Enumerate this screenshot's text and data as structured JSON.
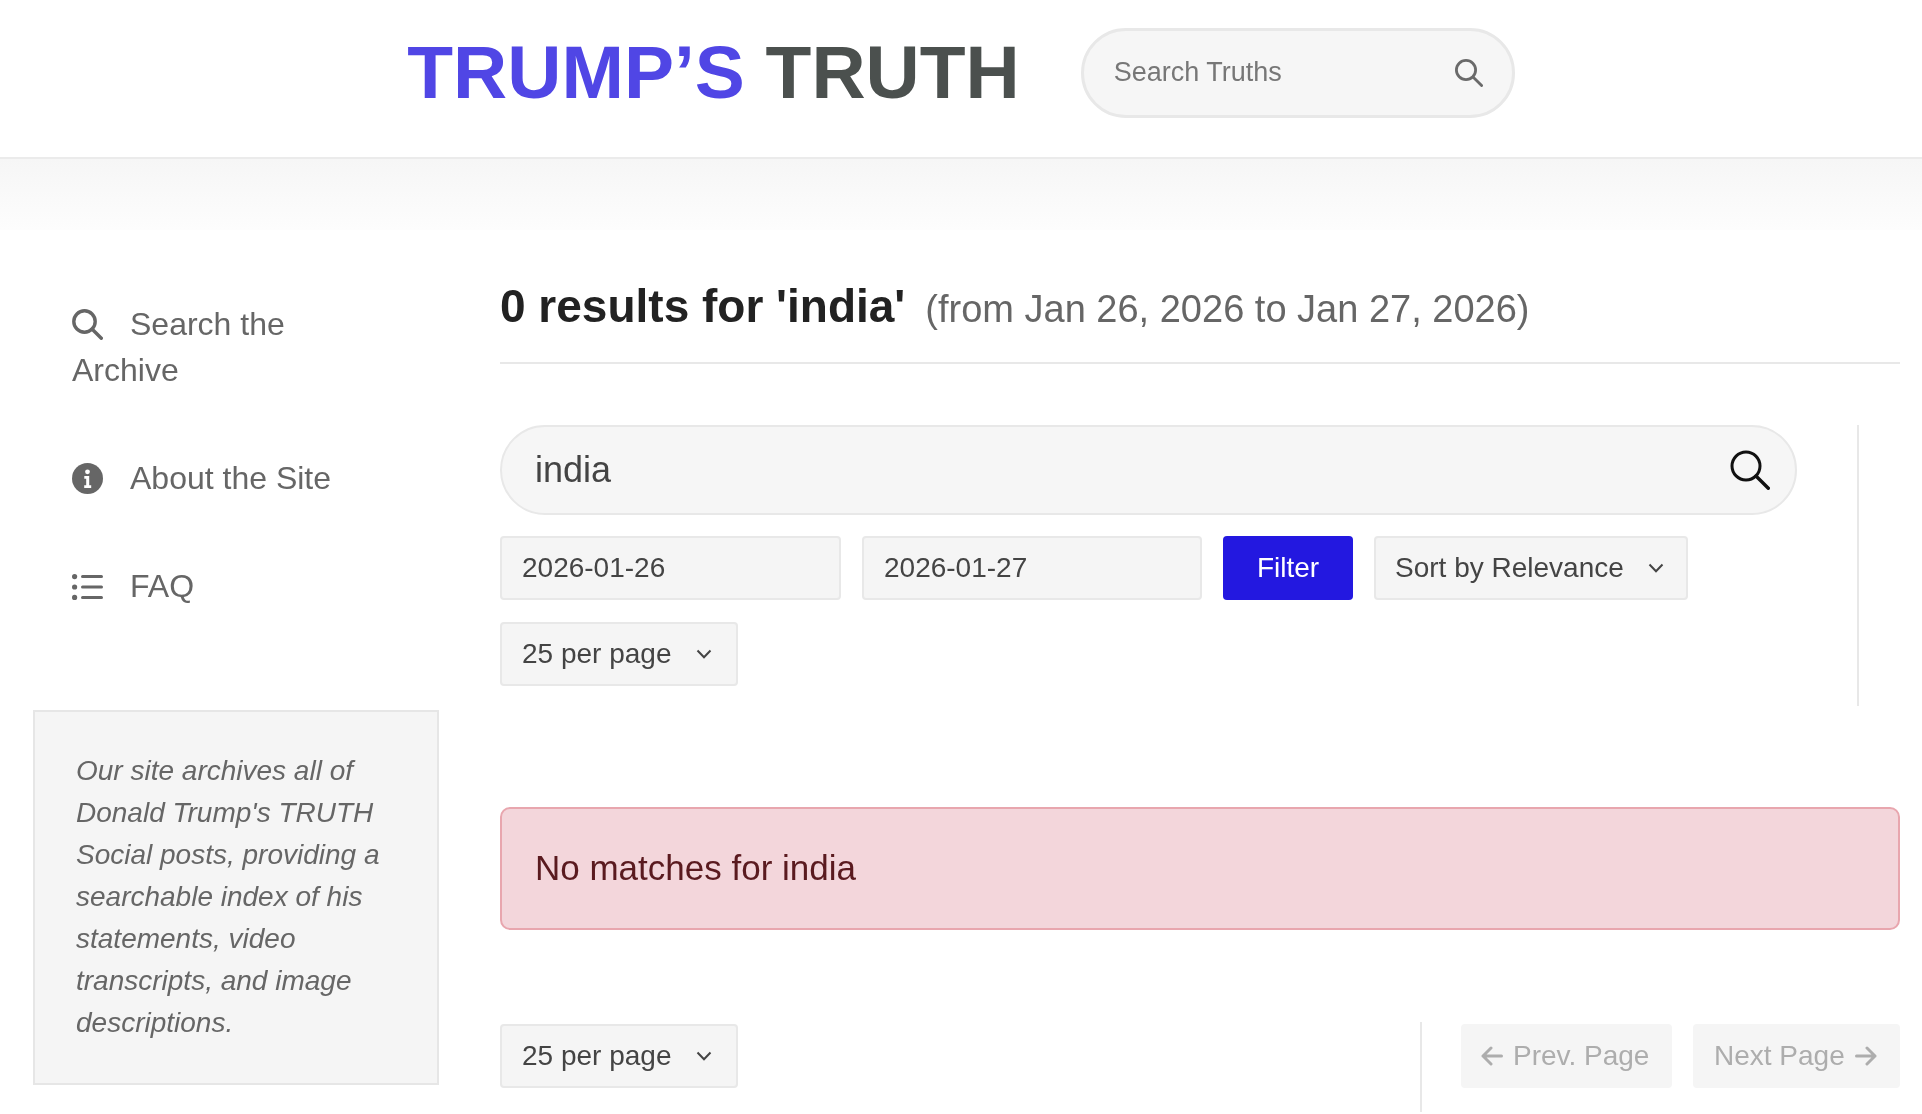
{
  "header": {
    "logo": {
      "words": [
        "TRUMP’S",
        "TRUTH"
      ]
    },
    "search": {
      "placeholder": "Search Truths"
    }
  },
  "sidebar": {
    "items": [
      {
        "label": "Search the Archive"
      },
      {
        "label": "About the Site"
      },
      {
        "label": "FAQ"
      }
    ],
    "about": "Our site archives all of Donald Trump's TRUTH Social posts, providing a searchable index of his statements, video transcripts, and image descriptions."
  },
  "results": {
    "heading": "0 results for 'india'",
    "range": "(from Jan 26, 2026 to Jan 27, 2026)"
  },
  "search": {
    "value": "india"
  },
  "filters": {
    "from_date": "2026-01-26",
    "to_date": "2026-01-27",
    "filter_button": "Filter",
    "sort": "Sort by Relevance",
    "per_page": "25 per page"
  },
  "alert": "No matches for india",
  "pagination": {
    "per_page": "25 per page",
    "buttons": [
      {
        "kind": "prev",
        "label": "Prev. Page",
        "disabled": true
      },
      {
        "kind": "next",
        "label": "Next Page",
        "disabled": true
      }
    ]
  }
}
